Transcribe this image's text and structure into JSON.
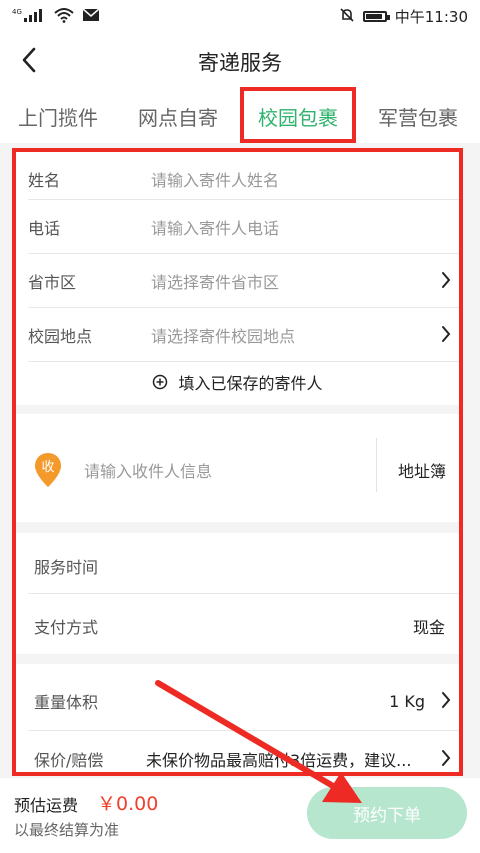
{
  "status_bar": {
    "network": "4G",
    "time": "中午11:30"
  },
  "header": {
    "title": "寄递服务"
  },
  "tabs": [
    {
      "label": "上门揽件",
      "active": false
    },
    {
      "label": "网点自寄",
      "active": false
    },
    {
      "label": "校园包裹",
      "active": true
    },
    {
      "label": "军营包裹",
      "active": false
    }
  ],
  "sender": {
    "name_label": "姓名",
    "name_placeholder": "请输入寄件人姓名",
    "phone_label": "电话",
    "phone_placeholder": "请输入寄件人电话",
    "region_label": "省市区",
    "region_placeholder": "请选择寄件省市区",
    "campus_label": "校园地点",
    "campus_placeholder": "请选择寄件校园地点",
    "saved_link": "填入已保存的寄件人"
  },
  "receiver": {
    "badge": "收",
    "placeholder": "请输入收件人信息",
    "address_book": "地址簿"
  },
  "service": {
    "time_label": "服务时间",
    "payment_label": "支付方式",
    "payment_value": "现金"
  },
  "package": {
    "weight_label": "重量体积",
    "weight_value": "1 Kg",
    "insurance_label": "保价/赔偿",
    "insurance_value": "未保价物品最高赔付3倍运费，建议..."
  },
  "footer": {
    "estimate_label": "预估运费",
    "estimate_price": "￥0.00",
    "estimate_note": "以最终结算为准",
    "order_button": "预约下单"
  },
  "colors": {
    "accent_green": "#2fb26d",
    "annotation_red": "#ee2a24",
    "price_red": "#f0402e",
    "button_disabled": "#b7e6cf",
    "badge_orange": "#f39a2b"
  }
}
